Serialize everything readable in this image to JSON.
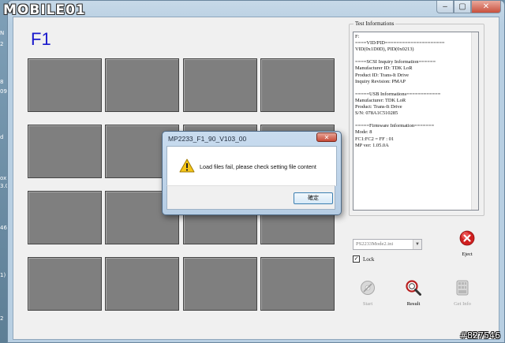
{
  "desktop": {
    "strip_text": [
      "N",
      "2",
      "8",
      "09",
      "d",
      "ox",
      "3.0",
      "46",
      "1)",
      "2"
    ]
  },
  "window": {
    "logo_text": "MOBILE01",
    "controls": {
      "minimize": "–",
      "maximize": "▢",
      "close": "✕"
    }
  },
  "ports": {
    "title": "F1",
    "cell_count": 16
  },
  "info": {
    "legend": "Test Informations",
    "text": "F:\n====VID/PID=====================\nVID(0x1D0D), PID(0x0213)\n\n====SCSI Inquiry Information======\nManufacturer ID: TDK LoR\nProduct ID: Trans-It Drive\nInquiry Revision: PMAP\n\n=====USB Informations============\nManufacturer: TDK LoR\nProduct: Trans-It Drive\nS/N: 078A1C510285\n\n=====Firmware Information=======\nMode: 8\nFC1:FC2 = FF : 01\nMP ver: 1.05.0A"
  },
  "controls": {
    "mode_select": {
      "value": "PS2233Mode2.ini"
    },
    "lock": {
      "label": "Lock",
      "checked": true
    },
    "eject": {
      "label": "Eject"
    },
    "start": {
      "label": "Start"
    },
    "result": {
      "label": "Result"
    },
    "get_info": {
      "label": "Get Info"
    }
  },
  "dialog": {
    "title": "MP2233_F1_90_V103_00",
    "close_glyph": "✕",
    "message": "Load files fail, please check setting file content",
    "ok_label": "確定"
  },
  "watermark": "#827546",
  "colors": {
    "port_title": "#1a1acc",
    "eject_red": "#d02020",
    "cell_gray": "#7f7f7f"
  }
}
